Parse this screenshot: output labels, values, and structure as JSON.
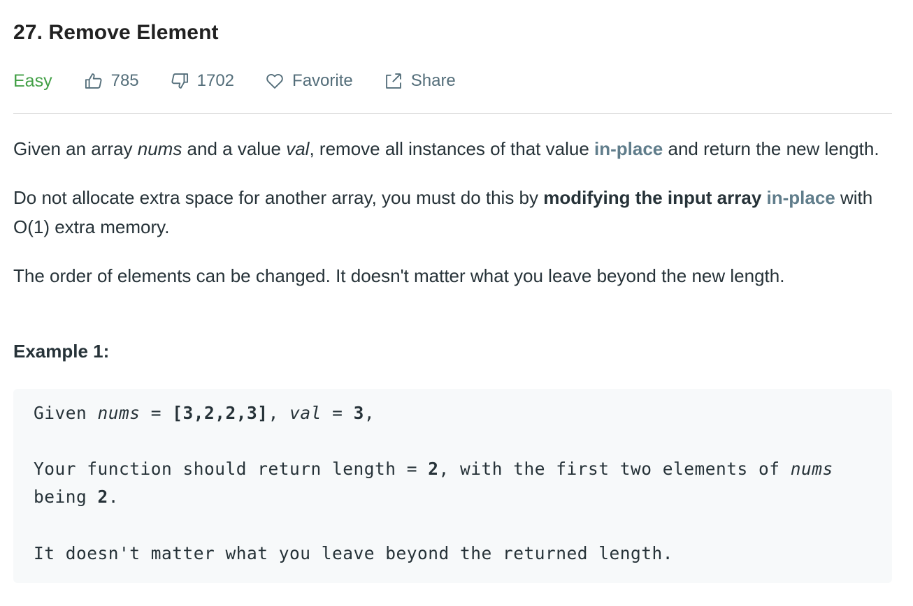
{
  "problem": {
    "title": "27. Remove Element",
    "difficulty": "Easy",
    "likes": "785",
    "dislikes": "1702",
    "favorite_label": "Favorite",
    "share_label": "Share"
  },
  "description": {
    "p1": {
      "t1": "Given an array ",
      "v1": "nums",
      "t2": " and a value ",
      "v2": "val",
      "t3": ", remove all instances of that value ",
      "hl": "in-place",
      "t4": " and return the new length."
    },
    "p2": {
      "t1": "Do not allocate extra space for another array, you must do this by ",
      "bold": "modifying the input array",
      "t2": " ",
      "hl": "in-place",
      "t3": " with O(1) extra memory."
    },
    "p3": "The order of elements can be changed. It doesn't matter what you leave beyond the new length."
  },
  "example": {
    "heading": "Example 1:",
    "line1": {
      "t1": "Given ",
      "v1": "nums",
      "t2": " = ",
      "b1": "[3,2,2,3]",
      "t3": ", ",
      "v2": "val",
      "t4": " = ",
      "b2": "3",
      "t5": ","
    },
    "line2": {
      "t1": "Your function should return length = ",
      "b1": "2",
      "t2": ", with the first two elements of ",
      "v1": "nums"
    },
    "line3": {
      "t1": "being ",
      "b1": "2",
      "t2": "."
    },
    "line4": "It doesn't matter what you leave beyond the returned length."
  },
  "colors": {
    "easy": "#43a047",
    "meta_gray": "#546e7a",
    "highlight": "#607d8b",
    "code_bg": "#f7f9fa"
  },
  "icons": {
    "like": "thumbs-up-icon",
    "dislike": "thumbs-down-icon",
    "favorite": "heart-icon",
    "share": "share-icon"
  }
}
